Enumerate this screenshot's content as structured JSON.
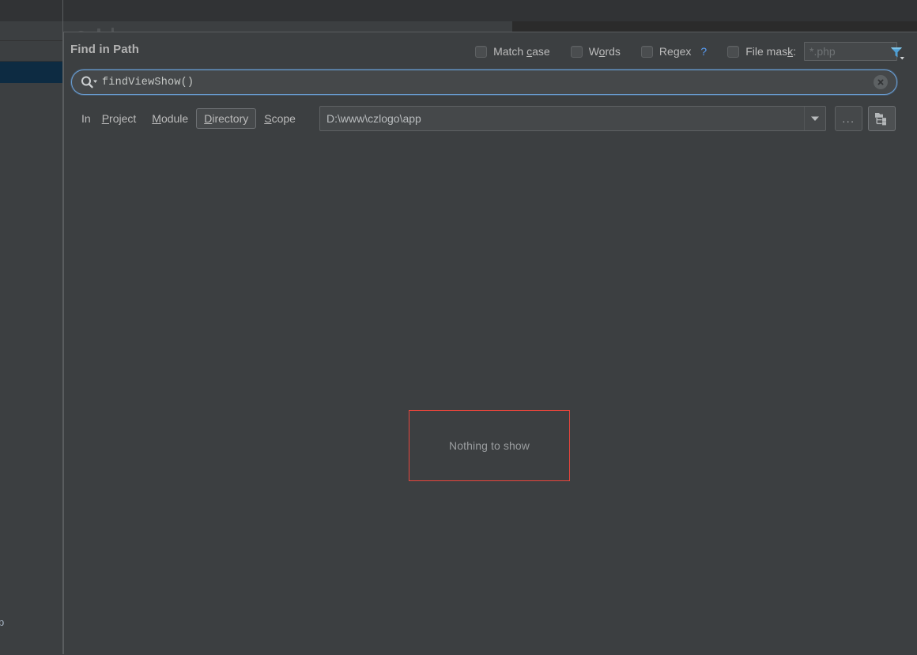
{
  "background": {
    "edge_text": "p",
    "toolbar_icons": [
      "clock-icon",
      "vcs-update-icon",
      "run-icon",
      "debug-icon",
      "coverage-icon"
    ]
  },
  "dialog": {
    "title": "Find in Path",
    "options": [
      {
        "id": "match-case",
        "label_pre": "Match ",
        "label_mnemonic": "c",
        "label_post": "ase",
        "checked": false
      },
      {
        "id": "words",
        "label_pre": "W",
        "label_mnemonic": "o",
        "label_post": "rds",
        "checked": false
      },
      {
        "id": "regex",
        "label_pre": "Re",
        "label_mnemonic": "g",
        "label_post": "ex",
        "checked": false,
        "help": "?"
      },
      {
        "id": "file-mask",
        "label_pre": "File mas",
        "label_mnemonic": "k",
        "label_post": ":",
        "checked": false
      }
    ],
    "file_mask": {
      "value": "",
      "placeholder": "*.php"
    },
    "filter_icon": "filter-funnel-icon",
    "search": {
      "value": "findViewShow()",
      "icon": "search-icon",
      "clear_icon": "clear-circle-icon"
    },
    "scope": {
      "prefix": "In ",
      "tabs": [
        {
          "id": "project",
          "pre": "",
          "mnemonic": "P",
          "post": "roject",
          "selected": false
        },
        {
          "id": "module",
          "pre": "",
          "mnemonic": "M",
          "post": "odule",
          "selected": false
        },
        {
          "id": "directory",
          "pre": "",
          "mnemonic": "D",
          "post": "irectory",
          "selected": true
        },
        {
          "id": "scope",
          "pre": "",
          "mnemonic": "S",
          "post": "cope",
          "selected": false
        }
      ],
      "path_value": "D:\\www\\czlogo\\app",
      "dropdown_icon": "chevron-down-icon",
      "browse_label": "...",
      "tree_toggle_icon": "folder-tree-icon"
    },
    "results": {
      "empty_message": "Nothing to show"
    }
  },
  "colors": {
    "dialog_bg": "#3c3f41",
    "field_bg": "#45484a",
    "accent_blue": "#589df6",
    "focus_border": "#6b9fd4",
    "highlight_red": "#e8453c",
    "text_primary": "#bbbbbb",
    "text_muted": "#9a9d9f",
    "selected_row": "#0d2b42"
  }
}
